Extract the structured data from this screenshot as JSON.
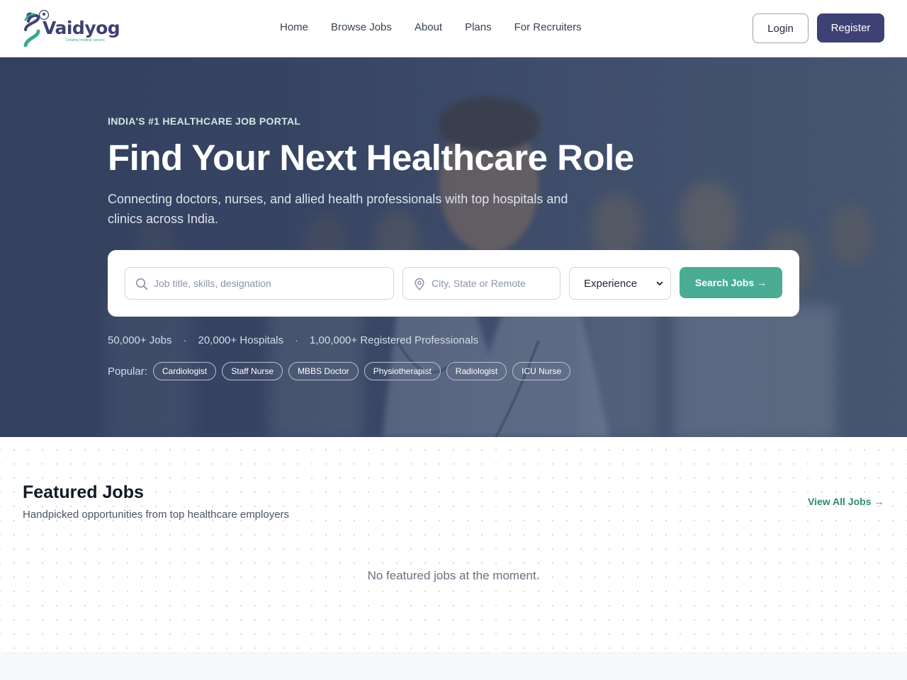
{
  "brand": {
    "name": "Vaidyog",
    "tagline": "Creating medical careers",
    "colors": {
      "primary": "#3d4173",
      "accent": "#4aad93",
      "link": "#2f8a71"
    }
  },
  "nav": {
    "links": [
      "Home",
      "Browse Jobs",
      "About",
      "Plans",
      "For Recruiters"
    ],
    "login_label": "Login",
    "register_label": "Register"
  },
  "hero": {
    "eyebrow": "INDIA'S #1 HEALTHCARE JOB PORTAL",
    "title": "Find Your Next Healthcare Role",
    "subtitle": "Connecting doctors, nurses, and allied health professionals with top hospitals and clinics across India.",
    "search": {
      "job_placeholder": "Job title, skills, designation",
      "job_icon": "search-icon",
      "location_placeholder": "City, State or Remote",
      "location_icon": "location-pin-icon",
      "experience_selected": "Experience",
      "button_label": "Search Jobs →"
    },
    "stats": [
      "50,000+ Jobs",
      "20,000+ Hospitals",
      "1,00,000+ Registered Professionals"
    ],
    "popular_label": "Popular:",
    "popular_tags": [
      "Cardiologist",
      "Staff Nurse",
      "MBBS Doctor",
      "Physiotherapist",
      "Radiologist",
      "ICU Nurse"
    ]
  },
  "featured": {
    "title": "Featured Jobs",
    "subtitle": "Handpicked opportunities from top healthcare employers",
    "view_all_label": "View All Jobs →",
    "empty_message": "No featured jobs at the moment."
  }
}
